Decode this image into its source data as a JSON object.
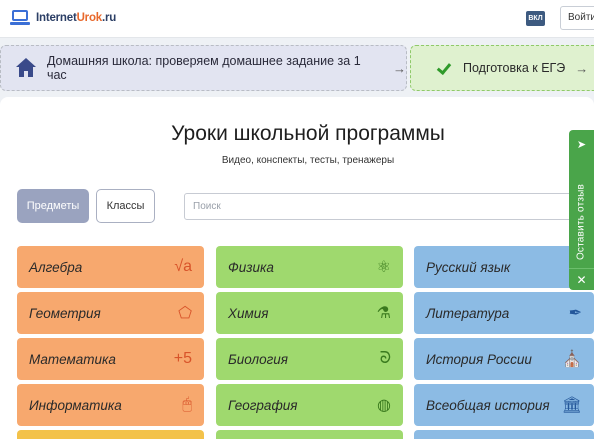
{
  "header": {
    "logo_part1": "Internet",
    "logo_part2": "Urok",
    "logo_part3": ".ru",
    "vk_label": "ВКЛ",
    "login_label": "Войти"
  },
  "banners": {
    "home_school": {
      "label": "Домашняя школа: проверяем домашнее задание за 1 час",
      "arrow": "→"
    },
    "ege": {
      "label": "Подготовка к ЕГЭ",
      "arrow": "→"
    }
  },
  "main": {
    "title": "Уроки школьной программы",
    "subtitle": "Видео, конспекты, тесты, тренажеры",
    "tabs": {
      "subjects": "Предметы",
      "classes": "Классы"
    },
    "search": {
      "placeholder": "Поиск",
      "value": ""
    }
  },
  "subjects": {
    "orange": [
      {
        "label": "Алгебра",
        "icon": "sqrt-a-icon",
        "glyph": "√a"
      },
      {
        "label": "Геометрия",
        "icon": "polyhedron-icon",
        "glyph": "⬠"
      },
      {
        "label": "Математика",
        "icon": "plus-five-icon",
        "glyph": "+5"
      },
      {
        "label": "Информатика",
        "icon": "mouse-icon",
        "glyph": "🖱"
      }
    ],
    "green": [
      {
        "label": "Физика",
        "icon": "atom-icon",
        "glyph": "⚛"
      },
      {
        "label": "Химия",
        "icon": "flask-icon",
        "glyph": "⚗"
      },
      {
        "label": "Биология",
        "icon": "dna-icon",
        "glyph": "ᘐ"
      },
      {
        "label": "География",
        "icon": "globe-icon",
        "glyph": "◍"
      }
    ],
    "blue": [
      {
        "label": "Русский язык",
        "icon": "text-icon",
        "glyph": ""
      },
      {
        "label": "Литература",
        "icon": "pen-icon",
        "glyph": "✒"
      },
      {
        "label": "История России",
        "icon": "church-icon",
        "glyph": "⛪"
      },
      {
        "label": "Всеобщая история",
        "icon": "column-building-icon",
        "glyph": "🏛"
      }
    ]
  },
  "feedback": {
    "send_glyph": "➤",
    "label": "Оставить отзыв",
    "close_glyph": "✕"
  },
  "colors": {
    "orange": "#f7a86e",
    "green": "#9fd96e",
    "blue": "#8cbbe4",
    "feedback": "#4aa54a",
    "tab_active": "#9aa3bf"
  }
}
